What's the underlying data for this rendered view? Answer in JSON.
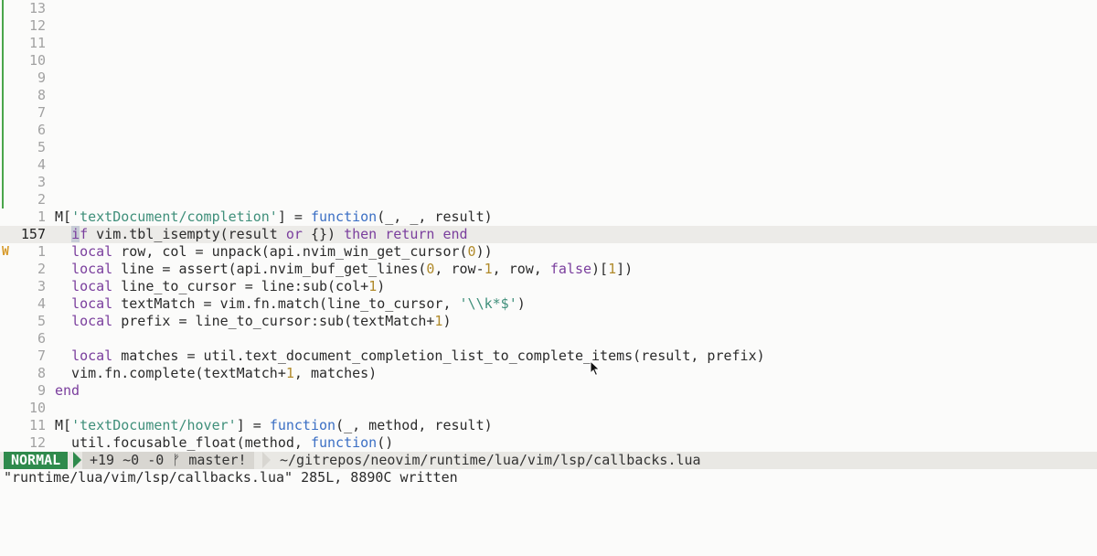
{
  "editor": {
    "relative_numbers_above": [
      "13",
      "12",
      "11",
      "10",
      "9",
      "8",
      "7",
      "6",
      "5",
      "4",
      "3",
      "2"
    ],
    "current_line_number": "157",
    "sign_warning": "W",
    "lines": [
      {
        "num": "1",
        "text": "M['textDocument/completion'] = function(_, _, result)"
      },
      {
        "num": "157",
        "text": "  if vim.tbl_isempty(result or {}) then return end"
      },
      {
        "num": "1",
        "text": "  local row, col = unpack(api.nvim_win_get_cursor(0))"
      },
      {
        "num": "2",
        "text": "  local line = assert(api.nvim_buf_get_lines(0, row-1, row, false)[1])"
      },
      {
        "num": "3",
        "text": "  local line_to_cursor = line:sub(col+1)"
      },
      {
        "num": "4",
        "text": "  local textMatch = vim.fn.match(line_to_cursor, '\\\\k*$')"
      },
      {
        "num": "5",
        "text": "  local prefix = line_to_cursor:sub(textMatch+1)"
      },
      {
        "num": "6",
        "text": ""
      },
      {
        "num": "7",
        "text": "  local matches = util.text_document_completion_list_to_complete_items(result, prefix)"
      },
      {
        "num": "8",
        "text": "  vim.fn.complete(textMatch+1, matches)"
      },
      {
        "num": "9",
        "text": "end"
      },
      {
        "num": "10",
        "text": ""
      },
      {
        "num": "11",
        "text": "M['textDocument/hover'] = function(_, method, result)"
      },
      {
        "num": "12",
        "text": "  util.focusable_float(method, function()"
      }
    ]
  },
  "statusline": {
    "mode": "NORMAL",
    "git_diff": "+19 ~0 -0",
    "branch_icon": "ᚠ",
    "branch": "master!",
    "path": "~/gitrepos/neovim/runtime/lua/vim/lsp/callbacks.lua"
  },
  "cmdline": {
    "message": "\"runtime/lua/vim/lsp/callbacks.lua\" 285L, 8890C written"
  },
  "colors": {
    "mode_bg": "#2f8a4c",
    "git_sign": "#4aa54a",
    "warning_sign": "#d79a2a",
    "keyword": "#7a3e9d",
    "function": "#3b6fc4",
    "string": "#3f8f7a"
  }
}
